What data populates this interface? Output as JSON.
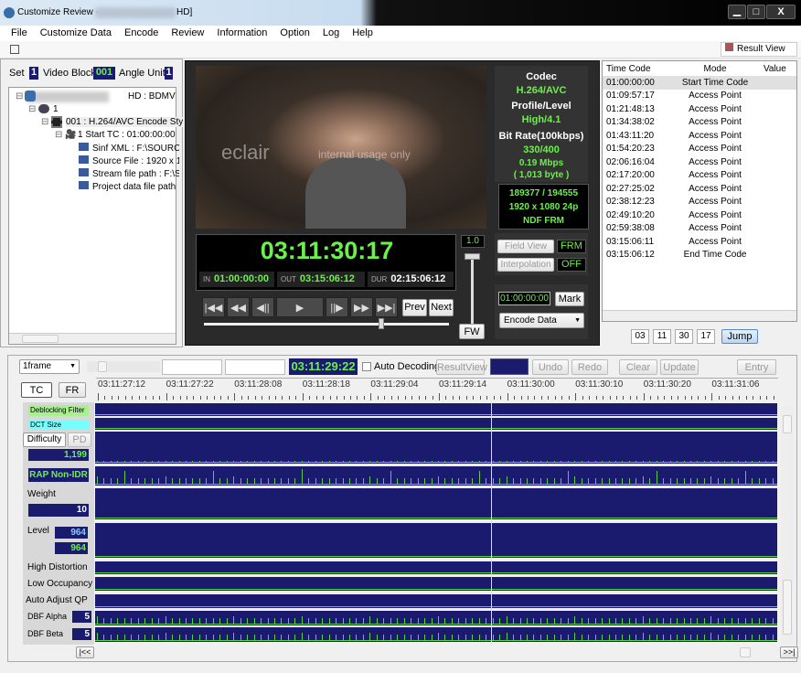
{
  "window": {
    "title_prefix": "Customize Review -",
    "title_suffix": "HD]",
    "min": "▁",
    "max": "□",
    "close": "X"
  },
  "menu": [
    "File",
    "Customize Data",
    "Encode",
    "Review",
    "Information",
    "Option",
    "Log",
    "Help"
  ],
  "toolbar": {
    "result_view": "Result View"
  },
  "selector": {
    "set_label": "Set",
    "set": "1",
    "video_block_label": "Video Block",
    "video_block": "001",
    "angle_label": "Angle Unit",
    "angle": "1"
  },
  "tree": {
    "root": "HD : BDMV",
    "disc": "1",
    "stream": "001 : H.264/AVC  Encode Sty",
    "start": "1  Start TC : 01:00:00:00",
    "items": [
      "Sinf XML  : F:\\SOURC",
      "Source File  : 1920 x 1",
      "Stream file path  : F:\\S",
      "Project data file path"
    ]
  },
  "video": {
    "watermark": "eclair",
    "watermark_sub": "internal usage only"
  },
  "info": {
    "codec_label": "Codec",
    "codec": "H.264/AVC",
    "profile_label": "Profile/Level",
    "profile": "High/4.1",
    "bitrate_label": "Bit Rate(100kbps)",
    "bitrate": "330/400",
    "mbps": "0.19  Mbps",
    "bytes": "(    1,013 byte )",
    "frames": "189377   /   194555",
    "resolution": "1920 x 1080 24p",
    "frm": "NDF FRM"
  },
  "player": {
    "timecode": "03:11:30:17",
    "in_label": "IN",
    "in": "01:00:00:00",
    "out_label": "OUT",
    "out": "03:15:06:12",
    "dur_label": "DUR",
    "dur": "02:15:06:12",
    "prev": "Prev",
    "next": "Next",
    "speed": "1.0",
    "fw": "FW",
    "position_pct": 73
  },
  "controls": {
    "field_view": "Field View",
    "field_view_val": "FRM",
    "interpolation": "Interpolation",
    "interpolation_val": "OFF",
    "mark_tc": "01:00:00:00",
    "mark": "Mark",
    "mode": "Encode Data"
  },
  "tc_table": {
    "headers": [
      "Time Code",
      "Mode",
      "Value"
    ],
    "rows": [
      [
        "01:00:00:00",
        "Start Time Code"
      ],
      [
        "01:09:57:17",
        "Access Point"
      ],
      [
        "01:21:48:13",
        "Access Point"
      ],
      [
        "01:34:38:02",
        "Access Point"
      ],
      [
        "01:43:11:20",
        "Access Point"
      ],
      [
        "01:54:20:23",
        "Access Point"
      ],
      [
        "02:06:16:04",
        "Access Point"
      ],
      [
        "02:17:20:00",
        "Access Point"
      ],
      [
        "02:27:25:02",
        "Access Point"
      ],
      [
        "02:38:12:23",
        "Access Point"
      ],
      [
        "02:49:10:20",
        "Access Point"
      ],
      [
        "02:59:38:08",
        "Access Point"
      ],
      [
        "03:15:06:11",
        "Access Point"
      ],
      [
        "03:15:06:12",
        "End Time Code"
      ]
    ]
  },
  "jump": {
    "h": "03",
    "m": "11",
    "s": "30",
    "f": "17",
    "label": "Jump"
  },
  "timeline": {
    "step": "1frame",
    "current": "03:11:29:22",
    "auto_decoding": "Auto Decoding",
    "result_view": "ResultView",
    "undo": "Undo",
    "redo": "Redo",
    "clear": "Clear",
    "update": "Update",
    "entry": "Entry",
    "tc": "TC",
    "fr": "FR",
    "ticks": [
      "03:11:27:12",
      "03:11:27:22",
      "03:11:28:08",
      "03:11:28:18",
      "03:11:29:04",
      "03:11:29:14",
      "03:11:30:00",
      "03:11:30:10",
      "03:11:30:20",
      "03:11:31:06"
    ],
    "first": "|<<",
    "last": ">>|"
  },
  "tracks": {
    "deblocking": "Deblocking Filter",
    "dct": "DCT Size",
    "difficulty": "Difficulty",
    "pd": "PD",
    "difficulty_val": "1,199",
    "rap": "RAP Non-IDR",
    "weight": "Weight",
    "weight_val": "10",
    "level": "Level",
    "level_a": "964",
    "level_b": "964",
    "high_distortion": "High Distortion",
    "low_occupancy": "Low Occupancy",
    "auto_qp": "Auto Adjust QP",
    "dbf_alpha": "DBF Alpha",
    "dbf_alpha_val": "5",
    "dbf_beta": "DBF Beta",
    "dbf_beta_val": "5"
  },
  "colors": {
    "accent_green": "#6cf04c",
    "navy": "#1a1a6e"
  }
}
